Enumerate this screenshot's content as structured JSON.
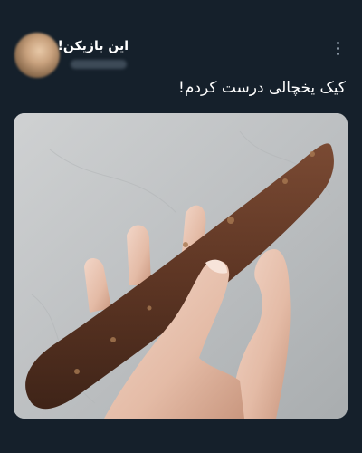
{
  "tweet": {
    "display_name": "این بازیکن!",
    "text": "کیک یخچالی درست کردم!",
    "more_icon": "more-vertical-icon",
    "colors": {
      "background": "#15202b",
      "text": "#ffffff",
      "muted": "#8b98a5"
    }
  }
}
